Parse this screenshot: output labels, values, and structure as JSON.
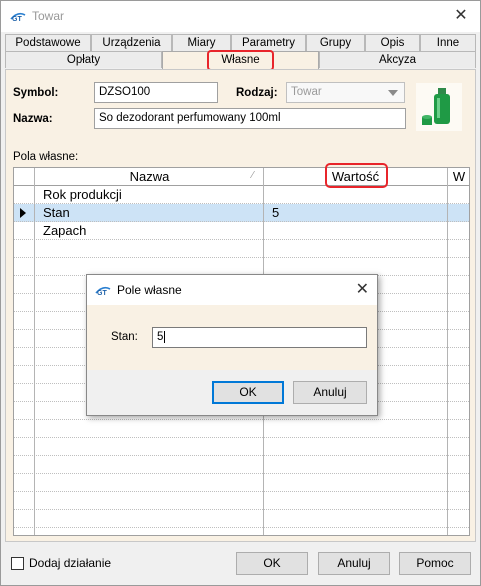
{
  "window": {
    "title": "Towar"
  },
  "tabs_row1": [
    "Podstawowe",
    "Urządzenia",
    "Miary",
    "Parametry",
    "Grupy",
    "Opis",
    "Inne"
  ],
  "tabs_row2": [
    "Opłaty",
    "Własne",
    "Akcyza"
  ],
  "form": {
    "symbol_label": "Symbol:",
    "symbol_value": "DZSO100",
    "rodzaj_label": "Rodzaj:",
    "rodzaj_value": "Towar",
    "nazwa_label": "Nazwa:",
    "nazwa_value": "So dezodorant perfumowany 100ml"
  },
  "section_label": "Pola własne:",
  "grid": {
    "columns": [
      "Nazwa",
      "Wartość",
      "W"
    ],
    "rows": [
      {
        "nazwa": "Rok produkcji",
        "wartosc": ""
      },
      {
        "nazwa": "Stan",
        "wartosc": "5",
        "selected": true
      },
      {
        "nazwa": "Zapach",
        "wartosc": ""
      }
    ]
  },
  "dialog": {
    "title": "Pole własne",
    "field_label": "Stan:",
    "field_value": "5",
    "ok_label": "OK",
    "cancel_label": "Anuluj"
  },
  "footer": {
    "checkbox_label": "Dodaj działanie",
    "ok_label": "OK",
    "cancel_label": "Anuluj",
    "help_label": "Pomoc"
  },
  "colors": {
    "highlight_red": "#e8252b",
    "selection_blue": "#cde3f6",
    "panel_beige": "#f9f1e4"
  },
  "icons": [
    "app-logo-icon",
    "close-icon",
    "dropdown-arrow-icon",
    "row-indicator-icon",
    "product-bottle-image"
  ]
}
